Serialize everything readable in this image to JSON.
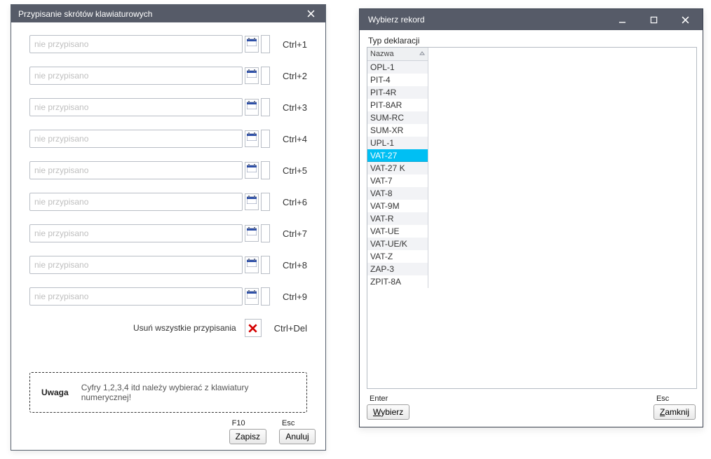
{
  "left": {
    "title": "Przypisanie skrótów klawiaturowych",
    "placeholder": "nie przypisano",
    "rows": [
      {
        "shortcut": "Ctrl+1"
      },
      {
        "shortcut": "Ctrl+2"
      },
      {
        "shortcut": "Ctrl+3"
      },
      {
        "shortcut": "Ctrl+4"
      },
      {
        "shortcut": "Ctrl+5"
      },
      {
        "shortcut": "Ctrl+6"
      },
      {
        "shortcut": "Ctrl+7"
      },
      {
        "shortcut": "Ctrl+8"
      },
      {
        "shortcut": "Ctrl+9"
      }
    ],
    "delete_label": "Usuń wszystkie przypisania",
    "delete_shortcut": "Ctrl+Del",
    "note_heading": "Uwaga",
    "note_text": "Cyfry 1,2,3,4 itd należy wybierać z klawiatury numerycznej!",
    "save_hint": "F10",
    "save_label": "Zapisz",
    "cancel_hint": "Esc",
    "cancel_label": "Anuluj"
  },
  "right": {
    "title": "Wybierz rekord",
    "field_label": "Typ deklaracji",
    "column_header": "Nazwa",
    "selected_index": 7,
    "items": [
      "OPL-1",
      "PIT-4",
      "PIT-4R",
      "PIT-8AR",
      "SUM-RC",
      "SUM-XR",
      "UPL-1",
      "VAT-27",
      "VAT-27 K",
      "VAT-7",
      "VAT-8",
      "VAT-9M",
      "VAT-R",
      "VAT-UE",
      "VAT-UE/K",
      "VAT-Z",
      "ZAP-3",
      "ZPIT-8A"
    ],
    "choose_hint": "Enter",
    "choose_label": "Wybierz",
    "close_hint": "Esc",
    "close_label": "Zamknij"
  }
}
